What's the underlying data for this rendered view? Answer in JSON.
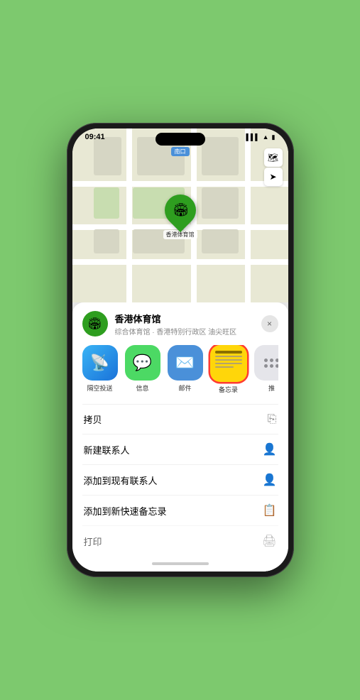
{
  "status_bar": {
    "time": "09:41",
    "signal": "▌▌▌",
    "wifi": "WiFi",
    "battery": "🔋"
  },
  "map": {
    "label": "南口",
    "controls": {
      "map_icon": "🗺",
      "location_icon": "➤"
    }
  },
  "marker": {
    "label": "香港体育馆"
  },
  "location_header": {
    "title": "香港体育馆",
    "subtitle": "综合体育馆 · 香港特别行政区 油尖旺区",
    "close_label": "×"
  },
  "share_items": [
    {
      "id": "airdrop",
      "label": "隔空投送",
      "emoji": "📡"
    },
    {
      "id": "message",
      "label": "信息",
      "emoji": "💬"
    },
    {
      "id": "mail",
      "label": "邮件",
      "emoji": "✉️"
    },
    {
      "id": "notes",
      "label": "备忘录",
      "emoji": ""
    },
    {
      "id": "more",
      "label": "推",
      "emoji": "⋯"
    }
  ],
  "actions": [
    {
      "id": "copy",
      "label": "拷贝",
      "icon": "⎘"
    },
    {
      "id": "new-contact",
      "label": "新建联系人",
      "icon": "👤"
    },
    {
      "id": "add-existing",
      "label": "添加到现有联系人",
      "icon": "👤"
    },
    {
      "id": "add-notes",
      "label": "添加到新快速备忘录",
      "icon": "📋"
    },
    {
      "id": "print",
      "label": "打印",
      "icon": "🖨"
    }
  ]
}
